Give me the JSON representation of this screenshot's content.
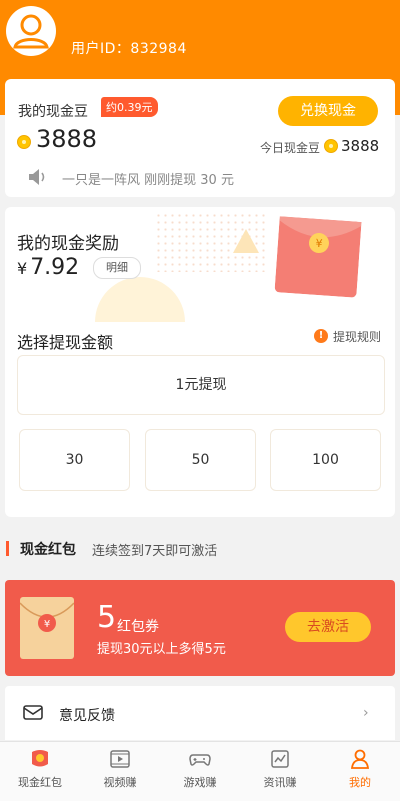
{
  "header": {
    "user_id": "用户ID：832984",
    "avatar_icon": "user-avatar-icon"
  },
  "beans": {
    "title": "我的现金豆",
    "approx_badge": "约0.39元",
    "value": "3888",
    "exchange_button": "兑换现金",
    "today_label": "今日现金豆",
    "today_value": "3888",
    "ticker": "一只是一阵风 刚刚提现 30 元"
  },
  "reward": {
    "title": "我的现金奖励",
    "currency": "¥",
    "amount": "7.92",
    "detail_button": "明细",
    "envelope_symbol": "¥"
  },
  "withdraw": {
    "title": "选择提现金额",
    "rules_icon_glyph": "!",
    "rules_label": "提现规则",
    "options": [
      "1元提现",
      "30",
      "50",
      "100"
    ]
  },
  "section": {
    "title": "现金红包",
    "subtitle": "连续签到7天即可激活"
  },
  "coupon": {
    "count": "5",
    "unit": "红包券",
    "desc": "提现30元以上多得5元",
    "button": "去激活",
    "envelope_symbol": "¥"
  },
  "feedback": {
    "label": "意见反馈",
    "chevron": "›"
  },
  "tabs": [
    {
      "label": "现金红包",
      "icon": "cash-redpacket-icon"
    },
    {
      "label": "视频赚",
      "icon": "video-icon"
    },
    {
      "label": "游戏赚",
      "icon": "gamepad-icon"
    },
    {
      "label": "资讯赚",
      "icon": "news-icon"
    },
    {
      "label": "我的",
      "icon": "profile-icon",
      "active": true
    }
  ],
  "colors": {
    "header": "#ff8a00",
    "accent": "#ff5a2e",
    "button_gold": "#ffb300",
    "coupon_bg": "#f15b4b"
  }
}
